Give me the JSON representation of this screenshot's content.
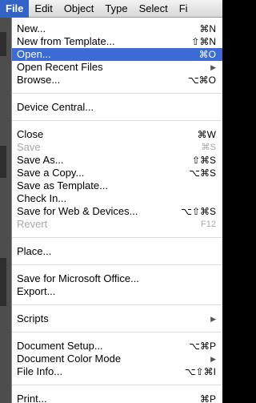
{
  "menubar": {
    "items": [
      "File",
      "Edit",
      "Object",
      "Type",
      "Select",
      "Fi"
    ],
    "active": "File"
  },
  "menu": {
    "groups": [
      [
        {
          "label": "New...",
          "shortcut": "⌘N"
        },
        {
          "label": "New from Template...",
          "shortcut": "⇧⌘N"
        },
        {
          "label": "Open...",
          "shortcut": "⌘O",
          "highlighted": true
        },
        {
          "label": "Open Recent Files",
          "submenu": true
        },
        {
          "label": "Browse...",
          "shortcut": "⌥⌘O"
        }
      ],
      [
        {
          "label": "Device Central..."
        }
      ],
      [
        {
          "label": "Close",
          "shortcut": "⌘W"
        },
        {
          "label": "Save",
          "shortcut": "⌘S",
          "disabled": true
        },
        {
          "label": "Save As...",
          "shortcut": "⇧⌘S"
        },
        {
          "label": "Save a Copy...",
          "shortcut": "⌥⌘S"
        },
        {
          "label": "Save as Template..."
        },
        {
          "label": "Check In..."
        },
        {
          "label": "Save for Web & Devices...",
          "shortcut": "⌥⇧⌘S"
        },
        {
          "label": "Revert",
          "shortcut": "F12",
          "disabled": true
        }
      ],
      [
        {
          "label": "Place..."
        }
      ],
      [
        {
          "label": "Save for Microsoft Office..."
        },
        {
          "label": "Export..."
        }
      ],
      [
        {
          "label": "Scripts",
          "submenu": true
        }
      ],
      [
        {
          "label": "Document Setup...",
          "shortcut": "⌥⌘P"
        },
        {
          "label": "Document Color Mode",
          "submenu": true
        },
        {
          "label": "File Info...",
          "shortcut": "⌥⇧⌘I"
        }
      ],
      [
        {
          "label": "Print...",
          "shortcut": "⌘P"
        }
      ]
    ]
  },
  "icons": {
    "submenu_arrow": "triangle-right-icon"
  },
  "colors": {
    "highlight": "#3d6bd6",
    "menubar_active": "#3463c8",
    "disabled": "#a8a8a8"
  }
}
